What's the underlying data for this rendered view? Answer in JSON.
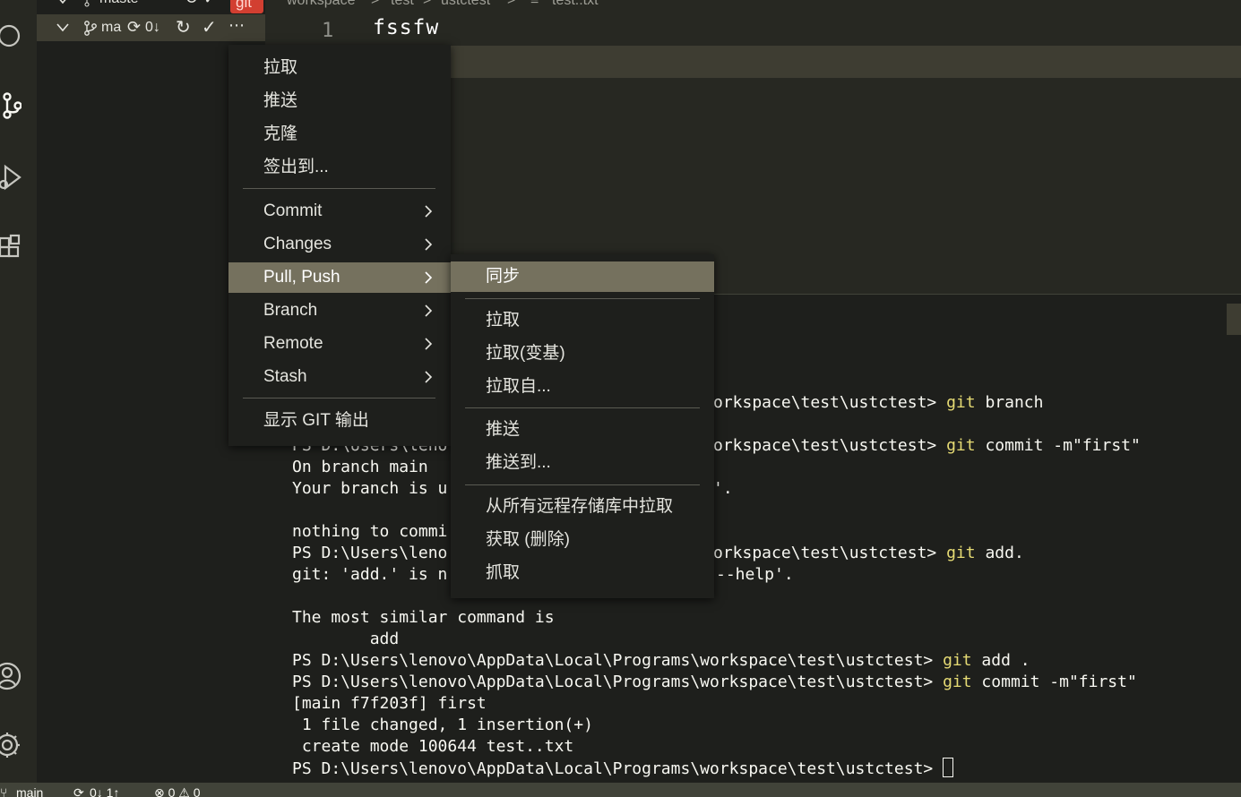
{
  "sidebar": {
    "row1": {
      "branch": "maste"
    },
    "row2": {
      "branch": "ma",
      "sync": "0↓"
    },
    "badge": "git"
  },
  "breadcrumb": [
    "workspace",
    ">",
    "test",
    ">",
    "ustctest",
    ">",
    "≡",
    "test..txt"
  ],
  "editor": {
    "line_number": "1",
    "line_text": "fssfw"
  },
  "main_menu": {
    "items_top": [
      "拉取",
      "推送",
      "克隆",
      "签出到..."
    ],
    "items_sub": [
      "Commit",
      "Changes",
      "Pull, Push",
      "Branch",
      "Remote",
      "Stash"
    ],
    "items_bottom": [
      "显示 GIT 输出"
    ]
  },
  "sub_menu": {
    "items": [
      "同步",
      "拉取",
      "拉取(变基)",
      "拉取自...",
      "推送",
      "推送到...",
      "从所有远程存储库中拉取",
      "获取 (删除)",
      "抓取"
    ]
  },
  "terminal": {
    "l1_tail": "orkspace\\test\\ustctest> ",
    "l1_cmd": "git",
    "l1_rest": " branch",
    "l2_head": "PS D:\\Users\\leno",
    "l2_tail": "orkspace\\test\\ustctest> ",
    "l2_cmd": "git",
    "l2_rest": " commit -m\"first\"",
    "l3": "On branch main",
    "l4_head": "Your branch is u",
    "l4_tail": "'.",
    "l5": "nothing to commi",
    "l6_head": "PS D:\\Users\\leno",
    "l6_tail": "orkspace\\test\\ustctest> ",
    "l6_cmd": "git",
    "l6_rest": " add.",
    "l7_head": "git: 'add.' is n",
    "l7_tail": "--help'.",
    "l8": "The most similar command is",
    "l9": "        add",
    "l10_prefix": "PS D:\\Users\\lenovo\\AppData\\Local\\Programs\\workspace\\test\\ustctest> ",
    "l10_cmd": "git",
    "l10_rest": " add .",
    "l11_prefix": "PS D:\\Users\\lenovo\\AppData\\Local\\Programs\\workspace\\test\\ustctest> ",
    "l11_cmd": "git",
    "l11_rest": " commit -m\"first\"",
    "l12": "[main f7f203f] first",
    "l13": " 1 file changed, 1 insertion(+)",
    "l14": " create mode 100644 test..txt",
    "l15_prefix": "PS D:\\Users\\lenovo\\AppData\\Local\\Programs\\workspace\\test\\ustctest> "
  },
  "status_bar": {
    "branch": "main",
    "sync": "0↓ 1↑",
    "problems": "⊗ 0 ⚠ 0"
  },
  "colors": {
    "menu_bg": "#1e1f1c",
    "active": "#75715e",
    "git_cmd": "#e6db74",
    "badge": "#d23f31"
  }
}
